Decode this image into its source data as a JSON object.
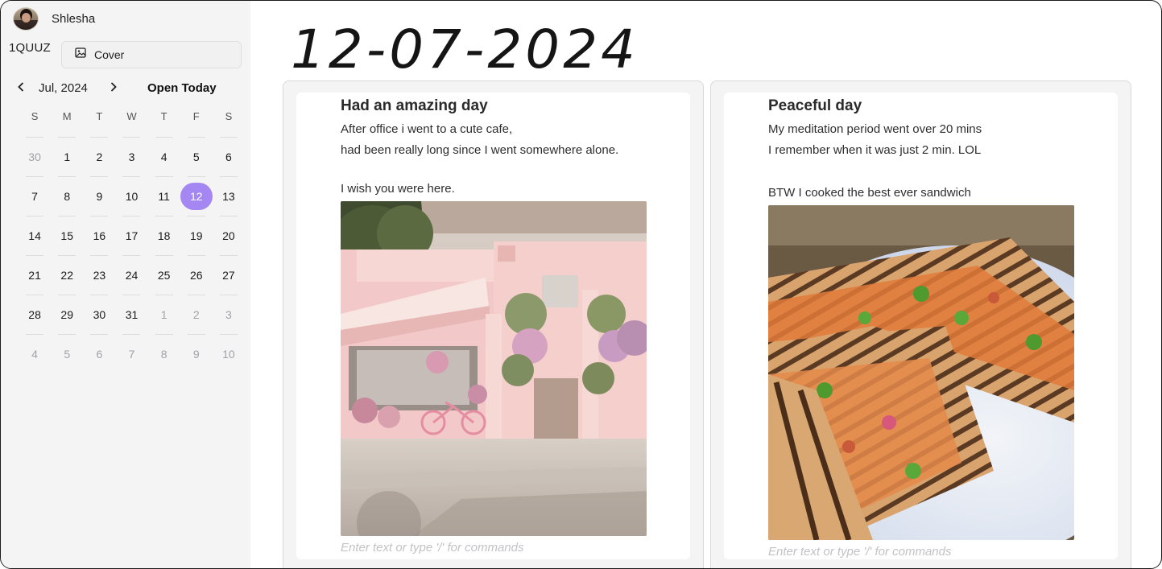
{
  "user": {
    "name": "Shlesha"
  },
  "workspace": {
    "code": "1QUUZ"
  },
  "cover_button": {
    "label": "Cover",
    "icon": "image-icon"
  },
  "calendar": {
    "month_label": "Jul, 2024",
    "open_today_label": "Open Today",
    "weekdays": [
      "S",
      "M",
      "T",
      "W",
      "T",
      "F",
      "S"
    ],
    "selected_day": "12",
    "days": [
      {
        "d": "30",
        "m": true
      },
      {
        "d": "1"
      },
      {
        "d": "2"
      },
      {
        "d": "3"
      },
      {
        "d": "4"
      },
      {
        "d": "5"
      },
      {
        "d": "6"
      },
      {
        "d": "7"
      },
      {
        "d": "8"
      },
      {
        "d": "9"
      },
      {
        "d": "10"
      },
      {
        "d": "11"
      },
      {
        "d": "12"
      },
      {
        "d": "13"
      },
      {
        "d": "14"
      },
      {
        "d": "15"
      },
      {
        "d": "16"
      },
      {
        "d": "17"
      },
      {
        "d": "18"
      },
      {
        "d": "19"
      },
      {
        "d": "20"
      },
      {
        "d": "21"
      },
      {
        "d": "22"
      },
      {
        "d": "23"
      },
      {
        "d": "24"
      },
      {
        "d": "25"
      },
      {
        "d": "26"
      },
      {
        "d": "27"
      },
      {
        "d": "28"
      },
      {
        "d": "29"
      },
      {
        "d": "30"
      },
      {
        "d": "31"
      },
      {
        "d": "1",
        "m": true
      },
      {
        "d": "2",
        "m": true
      },
      {
        "d": "3",
        "m": true
      },
      {
        "d": "4",
        "m": true
      },
      {
        "d": "5",
        "m": true
      },
      {
        "d": "6",
        "m": true
      },
      {
        "d": "7",
        "m": true
      },
      {
        "d": "8",
        "m": true
      },
      {
        "d": "9",
        "m": true
      },
      {
        "d": "10",
        "m": true
      }
    ]
  },
  "date_heading": "12-07-2024",
  "entries": [
    {
      "title": "Had an amazing day",
      "lines": [
        "After office i went to a cute cafe,",
        "had been really long since I went somewhere alone.",
        "I wish you were here."
      ],
      "photo": "pink-cafe-photo",
      "placeholder": "Enter text or type '/' for commands"
    },
    {
      "title": "Peaceful day",
      "lines": [
        "My meditation period went over 20 mins",
        "I remember when it was just 2 min. LOL",
        "BTW I cooked the best ever sandwich"
      ],
      "photo": "grilled-sandwich-photo",
      "placeholder": "Enter text or type '/' for commands"
    }
  ],
  "colors": {
    "accent": "#a487f2",
    "sidebar_bg": "#f4f4f5",
    "muted_text": "#a1a1a8"
  }
}
